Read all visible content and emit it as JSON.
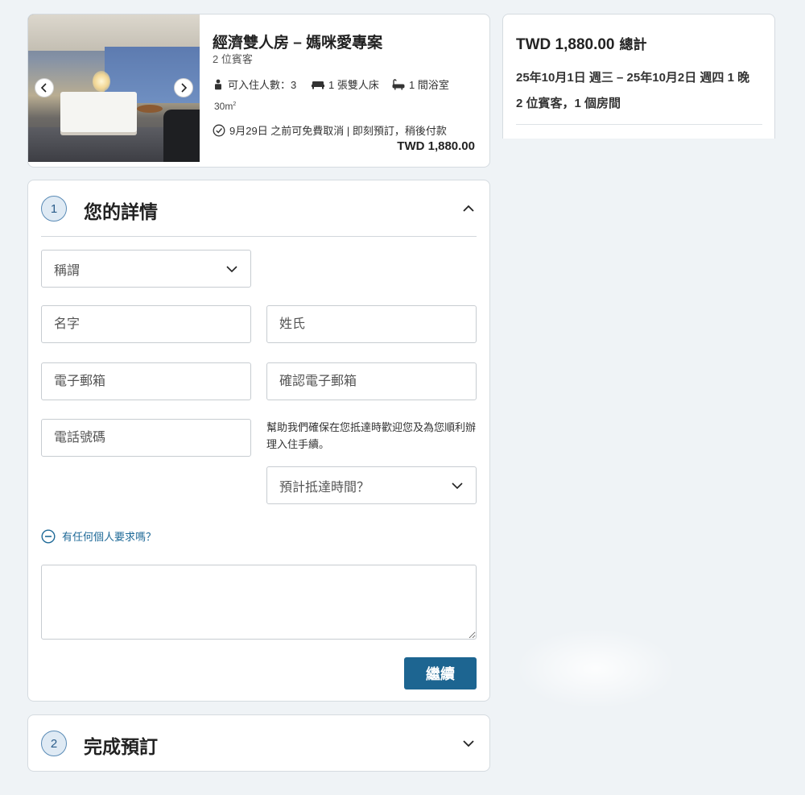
{
  "room": {
    "title": "經濟雙人房 – 媽咪愛專案",
    "guests": "2 位賓客",
    "occupancy": "可入住人數：3",
    "beds": "1 張雙人床",
    "bathrooms": "1 間浴室",
    "size": "30m",
    "size_unit_sup": "2",
    "cancellation": "9月29日 之前可免費取消 | 即刻預訂，稍後付款",
    "price": "TWD 1,880.00",
    "icons": [
      "chevron-left-icon",
      "chevron-right-icon",
      "person-icon",
      "bed-icon",
      "bathtub-icon",
      "check-circle-icon"
    ]
  },
  "summary": {
    "total_price": "TWD 1,880.00",
    "total_label": "總計",
    "dates": "25年10月1日 週三 – 25年10月2日 週四  1 晚",
    "rooms": "2 位賓客，1 個房間"
  },
  "step1": {
    "number": "1",
    "title": "您的詳情",
    "salutation_placeholder": "稱謂",
    "first_name_placeholder": "名字",
    "last_name_placeholder": "姓氏",
    "email_placeholder": "電子郵箱",
    "email_confirm_placeholder": "確認電子郵箱",
    "phone_placeholder": "電話號碼",
    "arrival_help": "幫助我們確保在您抵達時歡迎您及為您順利辦理入住手續。",
    "arrival_placeholder": "預計抵達時間？",
    "special_request_label": "有任何個人要求嗎？",
    "continue_label": "繼續"
  },
  "step2": {
    "number": "2",
    "title": "完成預訂"
  },
  "colors": {
    "accent": "#1d6591",
    "background": "#eff3f6",
    "link": "#1f6a98"
  }
}
